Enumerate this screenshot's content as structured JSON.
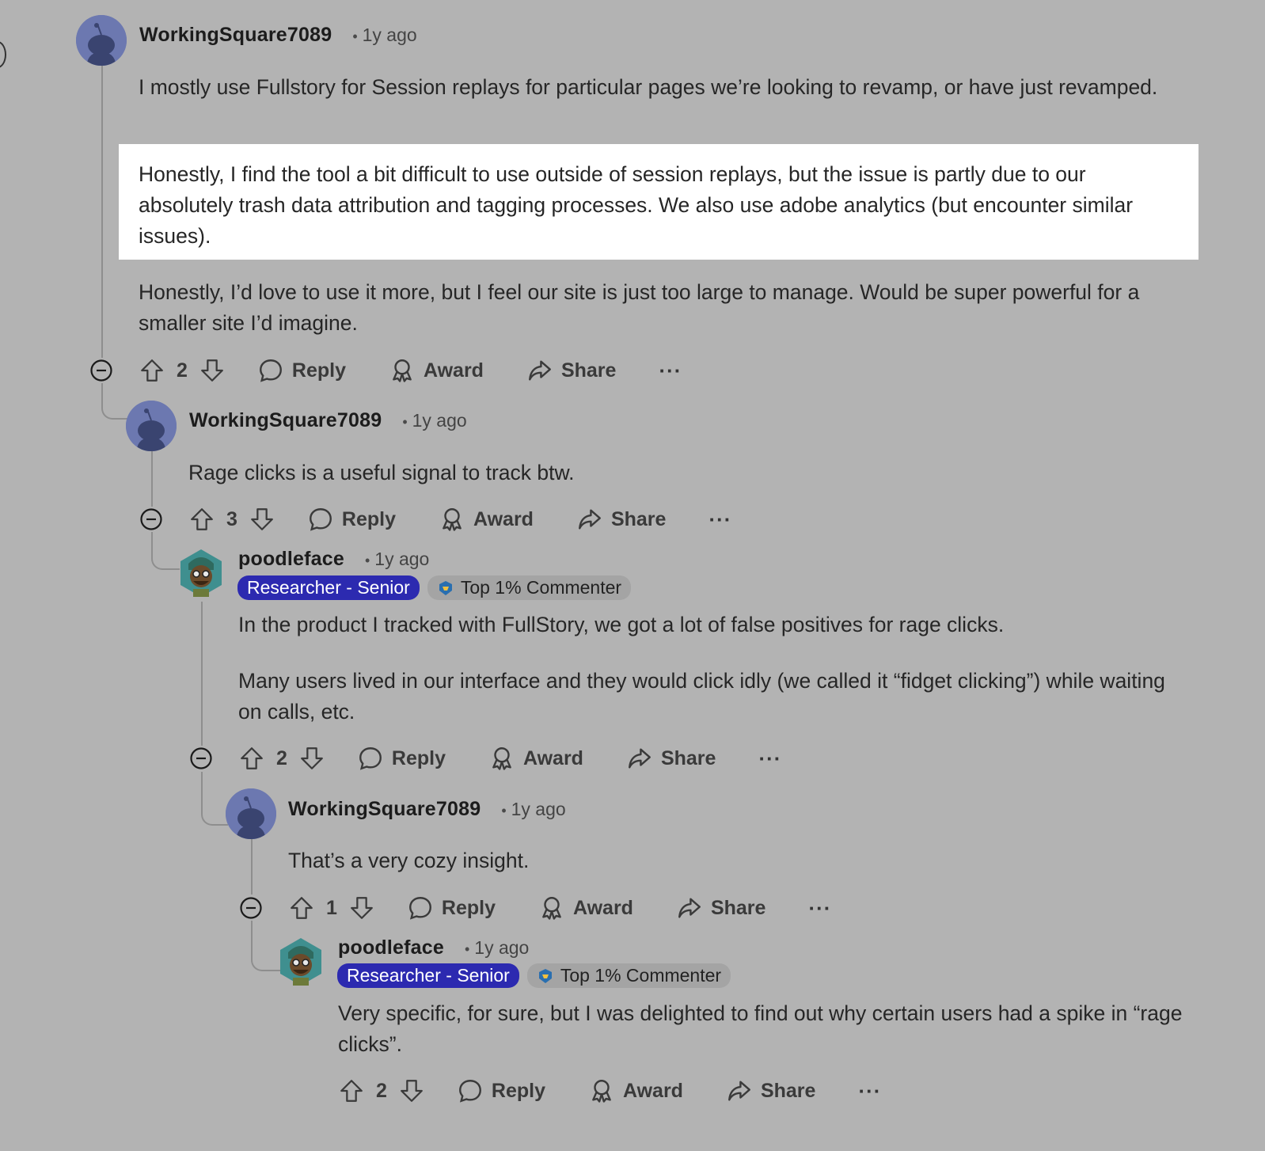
{
  "thread": {
    "comments": [
      {
        "author": "WorkingSquare7089",
        "age": "1y ago",
        "paragraphs": [
          "I mostly use Fullstory for Session replays for particular pages we’re looking to revamp, or have just revamped.",
          "Honestly, I find the tool a bit difficult to use outside of session replays, but the issue is partly due to our absolutely trash data attribution and tagging processes. We also use adobe analytics (but encounter similar issues).",
          "Honestly, I’d love to use it more, but I feel our site is just too large to manage. Would be super powerful for a smaller site I’d imagine."
        ],
        "votes": "2"
      },
      {
        "author": "WorkingSquare7089",
        "age": "1y ago",
        "paragraphs": [
          "Rage clicks is a useful signal to track btw."
        ],
        "votes": "3"
      },
      {
        "author": "poodleface",
        "age": "1y ago",
        "flair_role": "Researcher - Senior",
        "flair_top": "Top 1% Commenter",
        "paragraphs": [
          "In the product I tracked with FullStory, we got a lot of false positives for rage clicks.",
          "Many users lived in our interface and they would click idly (we called it “fidget clicking”) while waiting on calls, etc."
        ],
        "votes": "2"
      },
      {
        "author": "WorkingSquare7089",
        "age": "1y ago",
        "paragraphs": [
          "That’s a very cozy insight."
        ],
        "votes": "1"
      },
      {
        "author": "poodleface",
        "age": "1y ago",
        "flair_role": "Researcher - Senior",
        "flair_top": "Top 1% Commenter",
        "paragraphs": [
          "Very specific, for sure, but I was delighted to find out why certain users had a spike in “rage clicks”."
        ],
        "votes": "2"
      }
    ]
  },
  "actions": {
    "reply": "Reply",
    "award": "Award",
    "share": "Share",
    "more": "···"
  },
  "icons": {
    "upvote": "upvote-arrow-icon",
    "downvote": "downvote-arrow-icon",
    "reply": "speech-bubble-icon",
    "award": "ribbon-award-icon",
    "share": "share-arrow-icon",
    "collapse": "minus-circle-icon",
    "top_commenter": "trophy-badge-icon"
  },
  "colors": {
    "background": "#b3b3b3",
    "highlight": "#ffffff",
    "flair_role_bg": "#2c2ab0",
    "flair_top_bg": "#a4a4a4",
    "snoo_avatar_bg": "#6c78b0"
  }
}
